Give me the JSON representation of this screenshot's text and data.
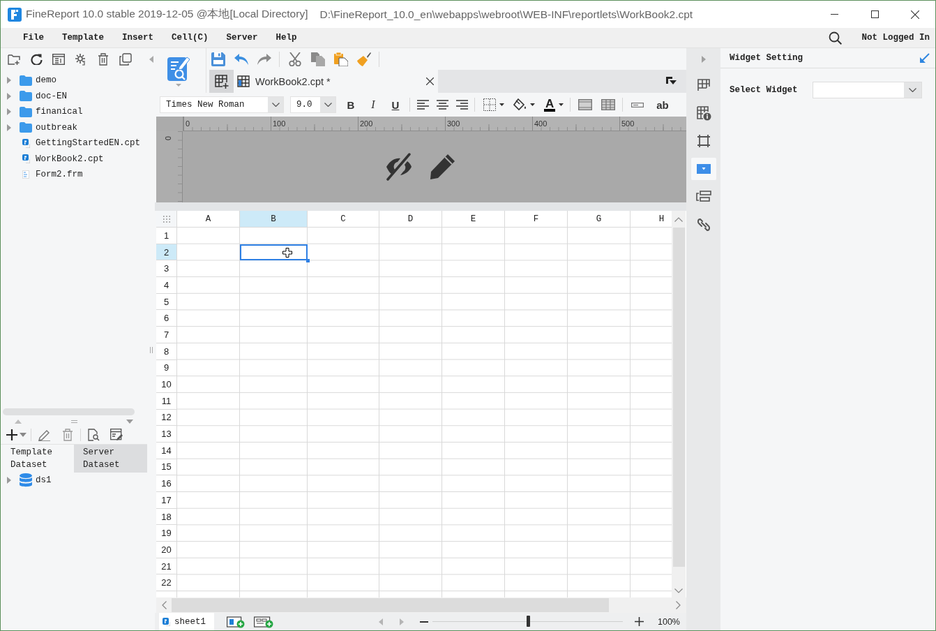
{
  "window": {
    "title": "FineReport 10.0 stable 2019-12-05 @本地[Local Directory]",
    "path": "D:\\FineReport_10.0_en\\webapps\\webroot\\WEB-INF\\reportlets\\WorkBook2.cpt"
  },
  "menu": [
    "File",
    "Template",
    "Insert",
    "Cell(C)",
    "Server",
    "Help"
  ],
  "account": "Not Logged In",
  "file_tree": [
    {
      "name": "demo",
      "kind": "folder",
      "expanded": false
    },
    {
      "name": "doc-EN",
      "kind": "folder",
      "expanded": false
    },
    {
      "name": "finanical",
      "kind": "folder",
      "expanded": false
    },
    {
      "name": "outbreak",
      "kind": "folder",
      "expanded": false
    },
    {
      "name": "GettingStartedEN.cpt",
      "kind": "report"
    },
    {
      "name": "WorkBook2.cpt",
      "kind": "report"
    },
    {
      "name": "Form2.frm",
      "kind": "form"
    }
  ],
  "dataset_tabs": [
    {
      "label": "Template Dataset",
      "selected": true
    },
    {
      "label": "Server Dataset",
      "selected": false
    }
  ],
  "datasets": [
    {
      "name": "ds1",
      "expanded": false
    }
  ],
  "document_tabs": [
    {
      "label": "WorkBook2.cpt *",
      "selected": true
    }
  ],
  "format_bar": {
    "font": "Times New Roman",
    "size": "9.0",
    "style_buttons": [
      "B",
      "I",
      "U"
    ],
    "font_color_glyph": "A",
    "wrap_button": "ab"
  },
  "ruler": {
    "top_marks": [
      "0",
      "100",
      "200",
      "300",
      "400",
      "500"
    ],
    "side_marks": [
      "0"
    ]
  },
  "sheet": {
    "columns": [
      {
        "label": "A",
        "selected": false
      },
      {
        "label": "B",
        "selected": true
      },
      {
        "label": "C",
        "selected": false
      },
      {
        "label": "D",
        "selected": false
      },
      {
        "label": "E",
        "selected": false
      },
      {
        "label": "F",
        "selected": false
      },
      {
        "label": "G",
        "selected": false
      },
      {
        "label": "H",
        "selected": false
      }
    ],
    "rows": [
      {
        "label": "1",
        "selected": false
      },
      {
        "label": "2",
        "selected": true
      },
      {
        "label": "3",
        "selected": false
      },
      {
        "label": "4",
        "selected": false
      },
      {
        "label": "5",
        "selected": false
      },
      {
        "label": "6",
        "selected": false
      },
      {
        "label": "7",
        "selected": false
      },
      {
        "label": "8",
        "selected": false
      },
      {
        "label": "9",
        "selected": false
      },
      {
        "label": "10",
        "selected": false
      },
      {
        "label": "11",
        "selected": false
      },
      {
        "label": "12",
        "selected": false
      },
      {
        "label": "13",
        "selected": false
      },
      {
        "label": "14",
        "selected": false
      },
      {
        "label": "15",
        "selected": false
      },
      {
        "label": "16",
        "selected": false
      },
      {
        "label": "17",
        "selected": false
      },
      {
        "label": "18",
        "selected": false
      },
      {
        "label": "19",
        "selected": false
      },
      {
        "label": "20",
        "selected": false
      },
      {
        "label": "21",
        "selected": false
      },
      {
        "label": "22",
        "selected": false
      }
    ]
  },
  "sheet_tabs": [
    {
      "label": "sheet1",
      "selected": true
    }
  ],
  "zoom": {
    "level": 0.5,
    "reading": "100%"
  },
  "side_tabs": [
    {
      "selected": false
    },
    {
      "selected": false
    },
    {
      "selected": false
    },
    {
      "selected": true
    },
    {
      "selected": false
    },
    {
      "selected": false
    }
  ],
  "widget_panel": {
    "title": "Widget Setting",
    "select_label": "Select Widget"
  }
}
